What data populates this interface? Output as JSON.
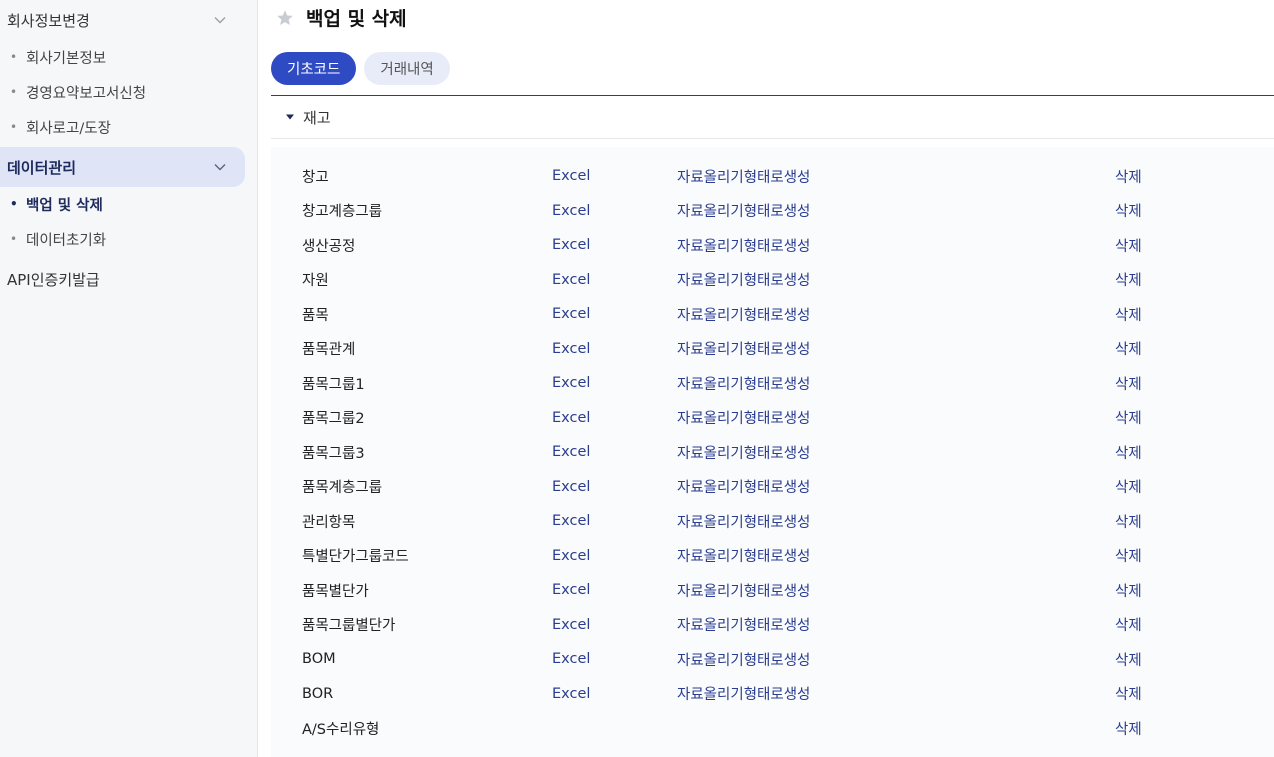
{
  "sidebar": {
    "group_company": "회사정보변경",
    "company_items": [
      "회사기본정보",
      "경영요약보고서신청",
      "회사로고/도장"
    ],
    "group_data": "데이터관리",
    "data_items": [
      "백업 및 삭제",
      "데이터초기화"
    ],
    "api": "API인증키발급"
  },
  "page": {
    "title": "백업 및 삭제"
  },
  "tabs": [
    "기초코드",
    "거래내역"
  ],
  "section": {
    "label": "재고"
  },
  "rows": [
    {
      "name": "창고",
      "excel": "Excel",
      "gen": "자료올리기형태로생성",
      "del": "삭제"
    },
    {
      "name": "창고계층그룹",
      "excel": "Excel",
      "gen": "자료올리기형태로생성",
      "del": "삭제"
    },
    {
      "name": "생산공정",
      "excel": "Excel",
      "gen": "자료올리기형태로생성",
      "del": "삭제"
    },
    {
      "name": "자원",
      "excel": "Excel",
      "gen": "자료올리기형태로생성",
      "del": "삭제"
    },
    {
      "name": "품목",
      "excel": "Excel",
      "gen": "자료올리기형태로생성",
      "del": "삭제"
    },
    {
      "name": "품목관계",
      "excel": "Excel",
      "gen": "자료올리기형태로생성",
      "del": "삭제"
    },
    {
      "name": "품목그룹1",
      "excel": "Excel",
      "gen": "자료올리기형태로생성",
      "del": "삭제"
    },
    {
      "name": "품목그룹2",
      "excel": "Excel",
      "gen": "자료올리기형태로생성",
      "del": "삭제"
    },
    {
      "name": "품목그룹3",
      "excel": "Excel",
      "gen": "자료올리기형태로생성",
      "del": "삭제"
    },
    {
      "name": "품목계층그룹",
      "excel": "Excel",
      "gen": "자료올리기형태로생성",
      "del": "삭제"
    },
    {
      "name": "관리항목",
      "excel": "Excel",
      "gen": "자료올리기형태로생성",
      "del": "삭제"
    },
    {
      "name": "특별단가그룹코드",
      "excel": "Excel",
      "gen": "자료올리기형태로생성",
      "del": "삭제"
    },
    {
      "name": "품목별단가",
      "excel": "Excel",
      "gen": "자료올리기형태로생성",
      "del": "삭제"
    },
    {
      "name": "품목그룹별단가",
      "excel": "Excel",
      "gen": "자료올리기형태로생성",
      "del": "삭제"
    },
    {
      "name": "BOM",
      "excel": "Excel",
      "gen": "자료올리기형태로생성",
      "del": "삭제"
    },
    {
      "name": "BOR",
      "excel": "Excel",
      "gen": "자료올리기형태로생성",
      "del": "삭제"
    },
    {
      "name": "A/S수리유형",
      "excel": "",
      "gen": "",
      "del": "삭제"
    }
  ],
  "colors": {
    "accent": "#2f4bc4",
    "link": "#2a3d8f",
    "sidebar_active_bg": "#dfe4f7"
  }
}
